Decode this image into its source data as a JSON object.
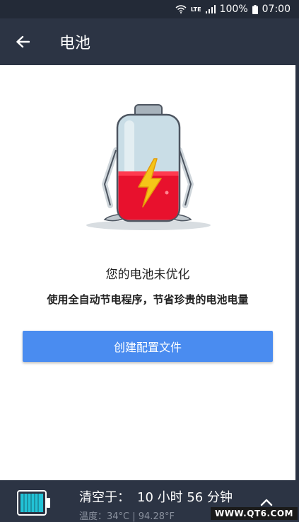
{
  "status_bar": {
    "network": "LTE",
    "battery_percent": "100%",
    "time": "07:00"
  },
  "app_bar": {
    "title": "电池"
  },
  "illustration": {
    "charge_level": 0.38,
    "charge_color": "#e8112d",
    "bolt_color": "#f5c518"
  },
  "message": {
    "title": "您的电池未优化",
    "subtitle": "使用全自动节电程序，节省珍贵的电池电量"
  },
  "actions": {
    "create_profile": "创建配置文件"
  },
  "bottom_bar": {
    "clear_label": "清空于：",
    "clear_time": "10 小时 56 分钟",
    "temp_info": "温度：34°C | 94.28°F"
  },
  "watermark": "WWW.QT6.COM",
  "colors": {
    "accent": "#4a8cf0",
    "header": "#2c3444",
    "battery_cyan": "#22c2d6"
  }
}
